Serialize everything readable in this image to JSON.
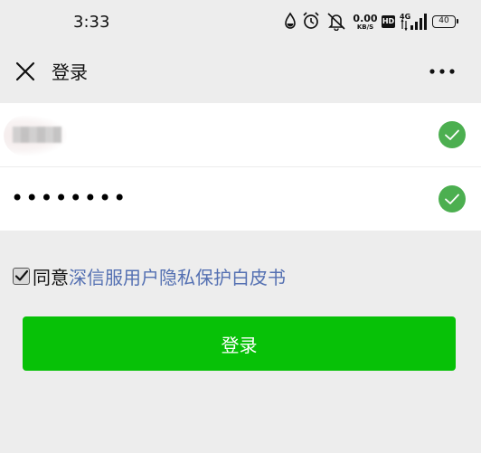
{
  "status_bar": {
    "time": "3:33",
    "net_speed_value": "0.00",
    "net_speed_unit": "KB/S",
    "hd_label": "HD",
    "network_type": "4G",
    "battery": "40",
    "icons": [
      "water-drop-icon",
      "alarm-icon",
      "mute-bell-icon",
      "net-speed",
      "hd-icon",
      "signal-icon",
      "battery-icon"
    ]
  },
  "nav": {
    "title": "登录",
    "close_icon": "close-icon",
    "more_icon": "more-icon"
  },
  "form": {
    "username_value": "",
    "password_value": "••••••••",
    "valid_icon": "check-circle-icon",
    "valid_color": "#4caf50"
  },
  "agreement": {
    "checked": true,
    "prefix": "同意",
    "link_text": "深信服用户隐私保护白皮书",
    "link_color": "#5470b2"
  },
  "login_button": {
    "label": "登录",
    "color": "#07c107"
  }
}
